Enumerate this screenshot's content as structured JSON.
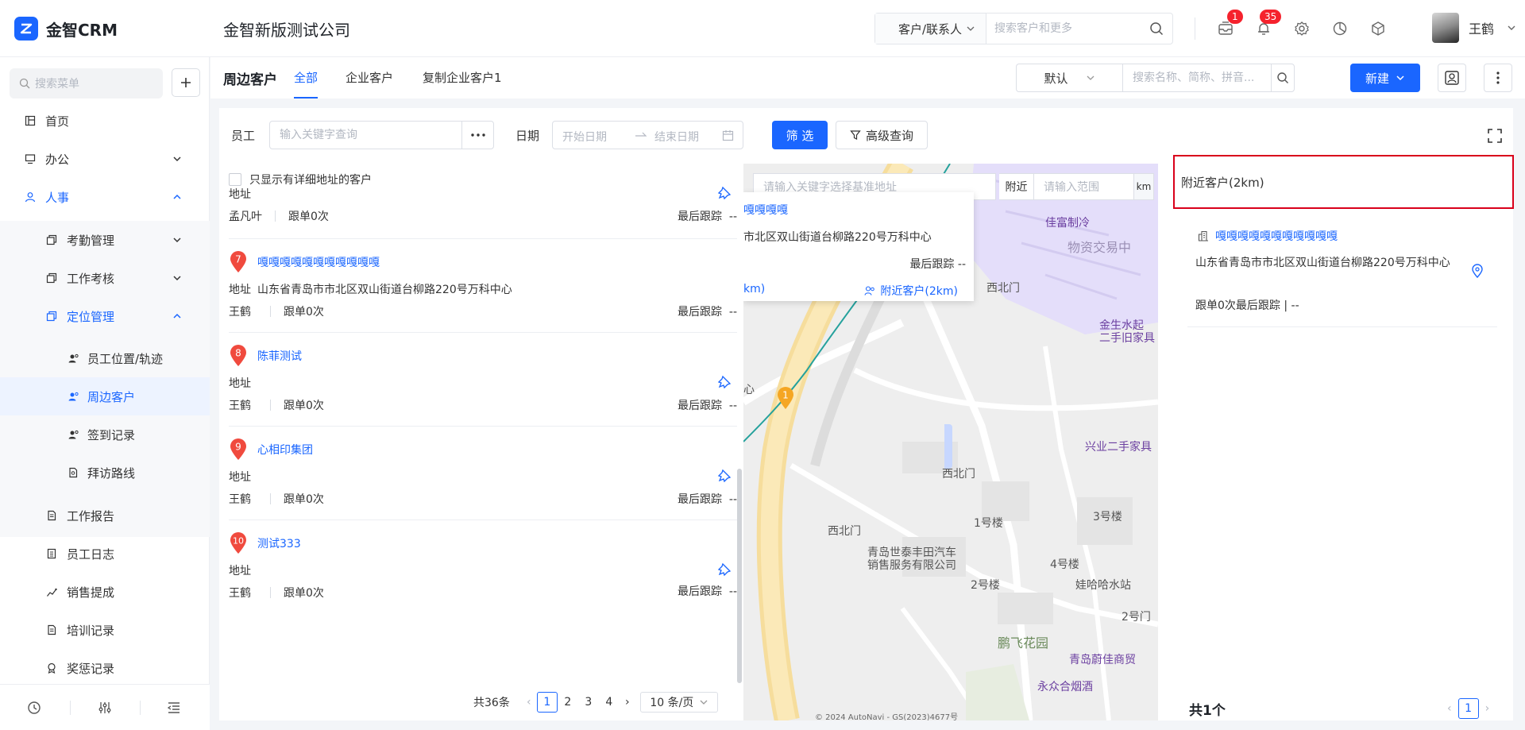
{
  "app": {
    "logo_text": "金智CRM",
    "company": "金智新版测试公司"
  },
  "global_search": {
    "type_label": "客户/联系人",
    "placeholder": "搜索客户和更多"
  },
  "notifications": {
    "message_count": "1",
    "bell_count": "35"
  },
  "user": {
    "name": "王鹤"
  },
  "sidebar": {
    "search_placeholder": "搜索菜单",
    "items": [
      {
        "label": "首页"
      },
      {
        "label": "办公"
      },
      {
        "label": "人事"
      },
      {
        "label": "考勤管理"
      },
      {
        "label": "工作考核"
      },
      {
        "label": "定位管理"
      },
      {
        "label": "员工位置/轨迹"
      },
      {
        "label": "周边客户"
      },
      {
        "label": "签到记录"
      },
      {
        "label": "拜访路线"
      },
      {
        "label": "工作报告"
      },
      {
        "label": "员工日志"
      },
      {
        "label": "销售提成"
      },
      {
        "label": "培训记录"
      },
      {
        "label": "奖惩记录"
      }
    ]
  },
  "page": {
    "title": "周边客户",
    "tabs": [
      "全部",
      "企业客户",
      "复制企业客户1"
    ],
    "view_select": "默认",
    "search_placeholder": "搜索名称、简称、拼音...",
    "new_label": "新建"
  },
  "filter": {
    "employee_label": "员工",
    "employee_placeholder": "输入关键字查询",
    "date_label": "日期",
    "start_placeholder": "开始日期",
    "end_placeholder": "结束日期",
    "filter_btn": "筛 选",
    "advanced_btn": "高级查询"
  },
  "list": {
    "only_detail_label": "只显示有详细地址的客户",
    "addr_key": "地址",
    "follow_prefix": "跟单",
    "last_follow_label": "最后跟踪",
    "partial": {
      "addr": "地址",
      "owner": "孟凡叶",
      "follow": "跟单0次",
      "last": "--"
    },
    "cards": [
      {
        "num": "7",
        "name": "嘎嘎嘎嘎嘎嘎嘎嘎嘎嘎嘎",
        "addr": "山东省青岛市市北区双山街道台柳路220号万科中心",
        "owner": "王鹤",
        "follow": "跟单0次",
        "last": "--"
      },
      {
        "num": "8",
        "name": "陈菲测试",
        "addr": "",
        "owner": "王鹤",
        "follow": "跟单0次",
        "last": "--"
      },
      {
        "num": "9",
        "name": "心相印集团",
        "addr": "",
        "owner": "王鹤",
        "follow": "跟单0次",
        "last": "--"
      },
      {
        "num": "10",
        "name": "测试333",
        "addr": "",
        "owner": "王鹤",
        "follow": "跟单0次",
        "last": "--"
      }
    ],
    "pager": {
      "total": "共36条",
      "pages": [
        "1",
        "2",
        "3",
        "4"
      ],
      "active": "1",
      "page_size": "10 条/页"
    }
  },
  "map": {
    "search_placeholder": "请输入关键字选择基准地址",
    "near_label": "附近",
    "range_placeholder": "请输入范围",
    "unit": "km",
    "popup": {
      "name": "嘎嘎嘎嘎",
      "addr": "市北区双山街道台柳路220号万科中心",
      "last": "最后跟踪  --",
      "km": "km)",
      "near": "附近客户(2km)"
    },
    "marker": "1",
    "labels": {
      "jiafu": "佳富制冷",
      "wuzi": "物资交易中",
      "xibeimen1": "西北门",
      "jinsheng": "金生水起\n二手旧家具",
      "xingye": "兴业二手家具",
      "xibeimen2": "西北门",
      "xibeimen3": "西北门",
      "yihaolou": "1号楼",
      "sanhaolou": "3号楼",
      "qingdao_fengtian": "青岛世泰丰田汽车\n销售服务有限公司",
      "sihaolou": "4号楼",
      "erhaolou": "2号楼",
      "wahaha": "娃哈哈水站",
      "erhaomen": "2号门",
      "pengfei": "鹏飞花园",
      "weijia": "青岛蔚佳商贸",
      "yongzhong": "永众合烟酒",
      "xin": "心",
      "copyright": "© 2024 AutoNavi - GS(2023)4677号"
    }
  },
  "right_panel": {
    "title": "附近客户(2km)",
    "item": {
      "name": "嘎嘎嘎嘎嘎嘎嘎嘎嘎嘎嘎",
      "addr": "山东省青岛市市北区双山街道台柳路220号万科中心",
      "meta": "跟单0次最后跟踪  |  --"
    },
    "total": "共1个",
    "page": "1"
  },
  "colors": {
    "accent": "#1a66ff",
    "pin_red": "#f04a3e",
    "highlight_border": "#d9001b",
    "marker_orange": "#f5a623"
  }
}
